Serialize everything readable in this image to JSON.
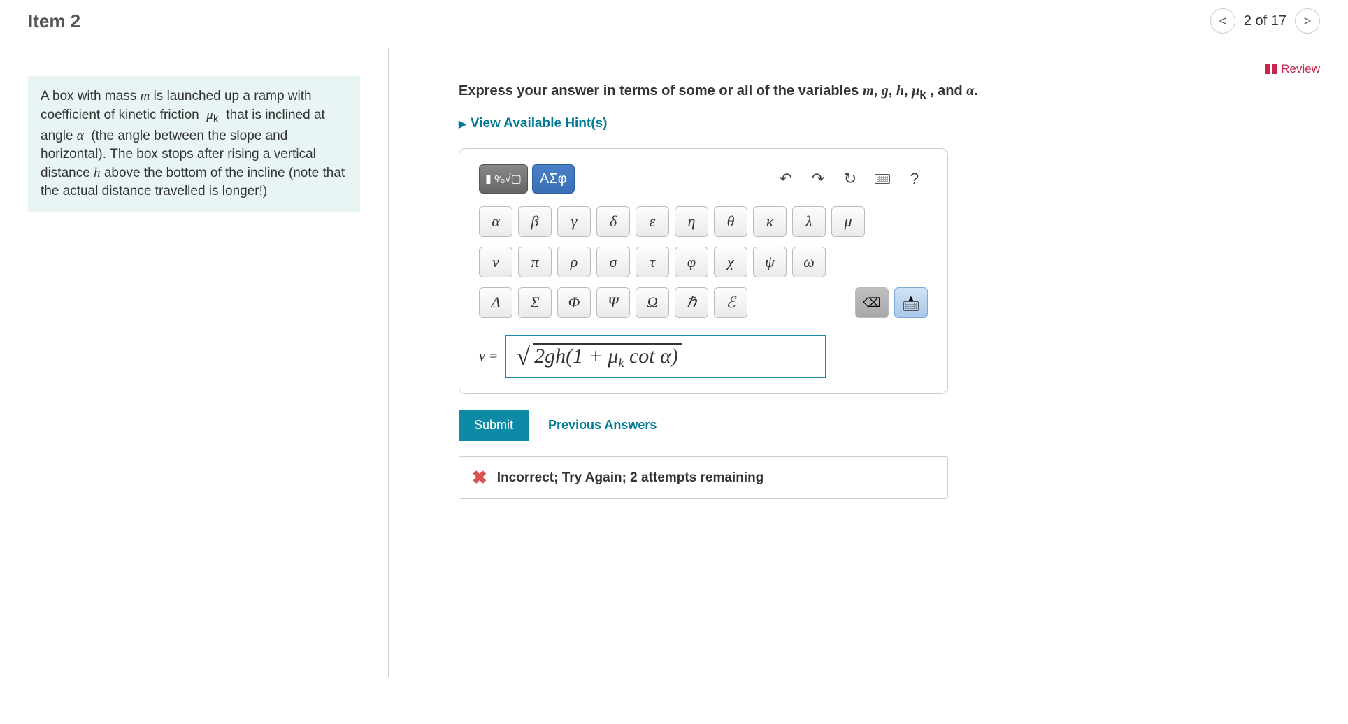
{
  "header": {
    "title": "Item 2",
    "progress": "2 of 17"
  },
  "problem": {
    "text_html": "A box with mass <span class='mi'>m</span> is launched up a ramp with coefficient of kinetic friction &nbsp;<span class='mi'>μ</span><sub>k</sub>&nbsp; that is inclined at angle <span class='mi'>α</span>&nbsp; (the angle between the slope and horizontal). The box stops after rising a vertical distance <span class='mi'>h</span> above the bottom of the incline (note that the actual distance travelled is longer!)"
  },
  "review_label": "Review",
  "instruction_html": "Express your answer in terms of some or all of the variables <span class='mi'>m</span>, <span class='mi'>g</span>, <span class='mi'>h</span>, <span class='mi'>μ</span><sub>k</sub> , and <span class='mi'>α</span>.",
  "hints_label": "View Available Hint(s)",
  "toolbar": {
    "templates_label": "▮ ᵒ⁄ₒ√▢",
    "greek_tab_label": "ΑΣφ",
    "undo_icon": "↶",
    "redo_icon": "↷",
    "reset_icon": "↻",
    "help_icon": "?"
  },
  "greek": {
    "row1": [
      "α",
      "β",
      "γ",
      "δ",
      "ε",
      "η",
      "θ",
      "κ",
      "λ",
      "μ"
    ],
    "row2": [
      "ν",
      "π",
      "ρ",
      "σ",
      "τ",
      "φ",
      "χ",
      "ψ",
      "ω"
    ],
    "row3": [
      "Δ",
      "Σ",
      "Φ",
      "Ψ",
      "Ω",
      "ℏ",
      "ℰ"
    ]
  },
  "util": {
    "backspace_icon": "⌫"
  },
  "answer": {
    "lhs": "v =",
    "display_html": "<span class='sqrt-sym'></span><span class='sqrt-body'>2<span class='mi'>gh</span>(1 + <span class='mi'>μ</span><span class='sub'>k</span> cot <span class='mi'>α</span>)</span>"
  },
  "actions": {
    "submit_label": "Submit",
    "prev_label": "Previous Answers"
  },
  "feedback": {
    "icon": "✖",
    "text": "Incorrect; Try Again; 2 attempts remaining"
  }
}
